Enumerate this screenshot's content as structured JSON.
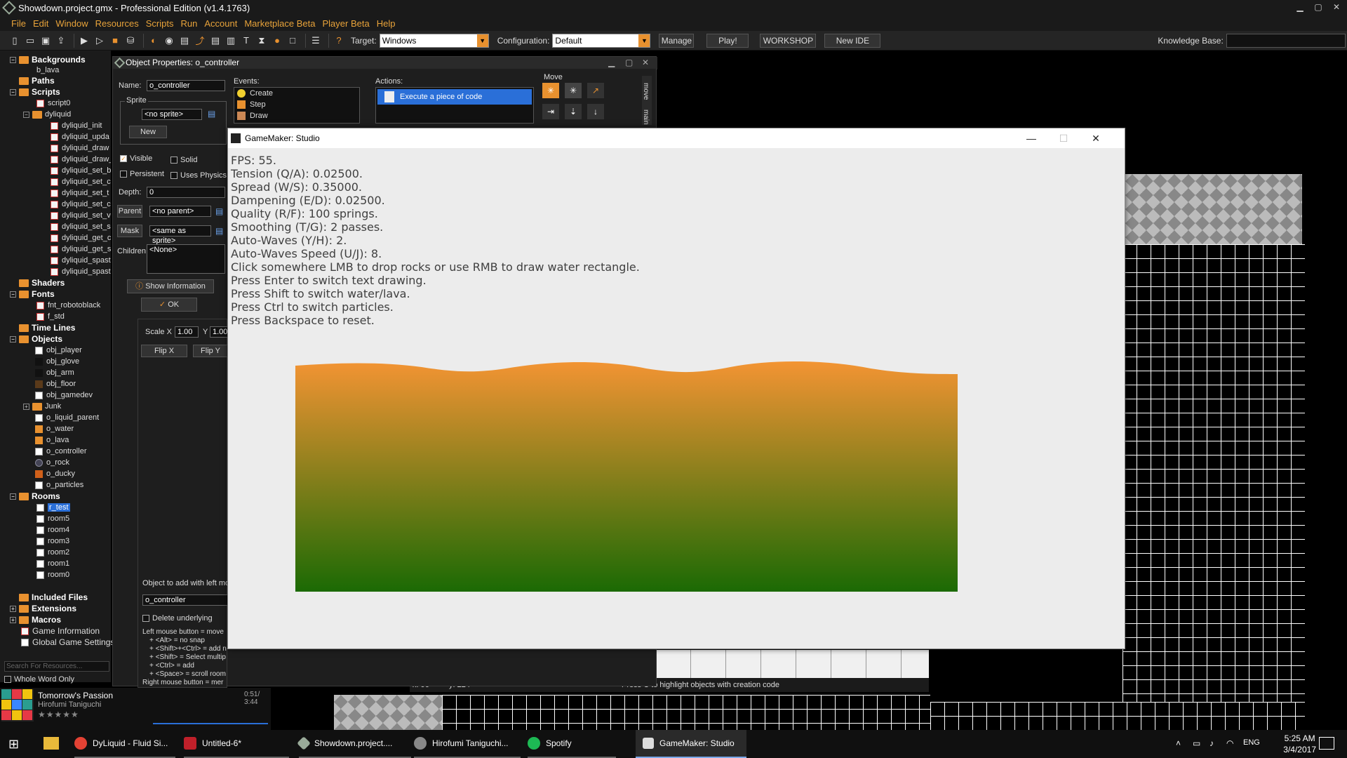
{
  "window": {
    "title": "Showdown.project.gmx  -  Professional Edition (v1.4.1763)"
  },
  "menu": [
    "File",
    "Edit",
    "Window",
    "Resources",
    "Scripts",
    "Run",
    "Account",
    "Marketplace Beta",
    "Player Beta",
    "Help"
  ],
  "toolbar": {
    "target_label": "Target:",
    "target_value": "Windows",
    "configuration_label": "Configuration:",
    "configuration_value": "Default",
    "manage_label": "Manage",
    "play_label": "Play!",
    "workshop_label": "WORKSHOP",
    "newide_label": "New IDE",
    "knowledge_label": "Knowledge Base:"
  },
  "tree": {
    "backgrounds": "Backgrounds",
    "b_lava": "b_lava",
    "paths": "Paths",
    "scripts": "Scripts",
    "script0": "script0",
    "dyliquid": "dyliquid",
    "dyliquid_items": [
      "dyliquid_init",
      "dyliquid_upda",
      "dyliquid_draw",
      "dyliquid_draw_",
      "dyliquid_set_b",
      "dyliquid_set_c",
      "dyliquid_set_t",
      "dyliquid_set_c",
      "dyliquid_set_v",
      "dyliquid_set_s",
      "dyliquid_get_c",
      "dyliquid_get_s",
      "dyliquid_spast",
      "dyliquid_spast"
    ],
    "shaders": "Shaders",
    "fonts": "Fonts",
    "fnt_robotoblack": "fnt_robotoblack",
    "f_std": "f_std",
    "timelines": "Time Lines",
    "objects": "Objects",
    "object_items": [
      "obj_player",
      "obj_glove",
      "obj_arm",
      "obj_floor",
      "obj_gamedev"
    ],
    "junk": "Junk",
    "object_items2": [
      "o_liquid_parent",
      "o_water",
      "o_lava",
      "o_controller",
      "o_rock",
      "o_ducky",
      "o_particles"
    ],
    "rooms": "Rooms",
    "room_items": [
      "r_test",
      "room5",
      "room4",
      "room3",
      "room2",
      "room1",
      "room0"
    ],
    "included_files": "Included Files",
    "extensions": "Extensions",
    "macros": "Macros",
    "game_information": "Game Information",
    "global_settings": "Global Game Settings",
    "search_placeholder": "Search For Resources...",
    "whole_word": "Whole Word Only"
  },
  "music": {
    "title": "Tomorrow's Passion",
    "artist": "Hirofumi Taniguchi",
    "stars": "★★★★★",
    "time": "0:51/ 3:44"
  },
  "object_props": {
    "title": "Object Properties: o_controller",
    "name_label": "Name:",
    "name_value": "o_controller",
    "sprite_label": "Sprite",
    "sprite_value": "<no sprite>",
    "new_label": "New",
    "visible_label": "Visible",
    "solid_label": "Solid",
    "persistent_label": "Persistent",
    "physics_label": "Uses Physics",
    "depth_label": "Depth:",
    "depth_value": "0",
    "parent_label": "Parent",
    "parent_value": "<no parent>",
    "mask_label": "Mask",
    "mask_value": "<same as sprite>",
    "children_label": "Children:",
    "children_value": "<None>",
    "show_info_label": "Show Information",
    "ok_label": "OK",
    "events_label": "Events:",
    "events": [
      "Create",
      "Step",
      "Draw"
    ],
    "actions_label": "Actions:",
    "action_item": "Execute a piece of code",
    "move_label": "Move",
    "tab_move": "move",
    "tab_main": "main"
  },
  "room_editor": {
    "scale_label": "Scale X",
    "scale_x": "1.00",
    "scale_y_label": "Y",
    "scale_y": "1.00",
    "flipx_label": "Flip X",
    "flipy_label": "Flip Y",
    "object_to_add_label": "Object to add with left mo",
    "object_to_add_value": "o_controller",
    "delete_underlying_label": "Delete underlying",
    "help_lines": [
      "Left mouse button = move",
      "+ <Alt> = no snap",
      "+ <Shift>+<Ctrl> = add n",
      "+ <Shift> = Select multip",
      "+ <Ctrl> = add",
      "+ <Space> = scroll room",
      "Right mouse button = mer"
    ],
    "status_x": "x: 96",
    "status_y": "y: 224",
    "status_hint": "Press C to highlight objects with creation code"
  },
  "game_window": {
    "title": "GameMaker: Studio",
    "hud": [
      "FPS: 55.",
      "Tension (Q/A): 0.02500.",
      "Spread (W/S): 0.35000.",
      "Dampening (E/D): 0.02500.",
      "Quality (R/F): 100 springs.",
      "Smoothing (T/G): 2 passes.",
      "Auto-Waves (Y/H): 2.",
      "Auto-Waves Speed (U/J): 8.",
      "Click somewhere LMB to drop rocks or use RMB to draw water rectangle.",
      "Press Enter to switch text drawing.",
      "Press Shift to switch water/lava.",
      "Press Ctrl to switch particles.",
      "Press Backspace to reset."
    ],
    "lava_top_color": "#f39433",
    "lava_bottom_color": "#1b6a04"
  },
  "taskbar": {
    "tasks": [
      "DyLiquid - Fluid Si...",
      "Untitled-6*",
      "Showdown.project....",
      "Hirofumi Taniguchi...",
      "Spotify",
      "GameMaker: Studio"
    ],
    "lang": "ENG",
    "time": "5:25 AM",
    "date": "3/4/2017"
  }
}
